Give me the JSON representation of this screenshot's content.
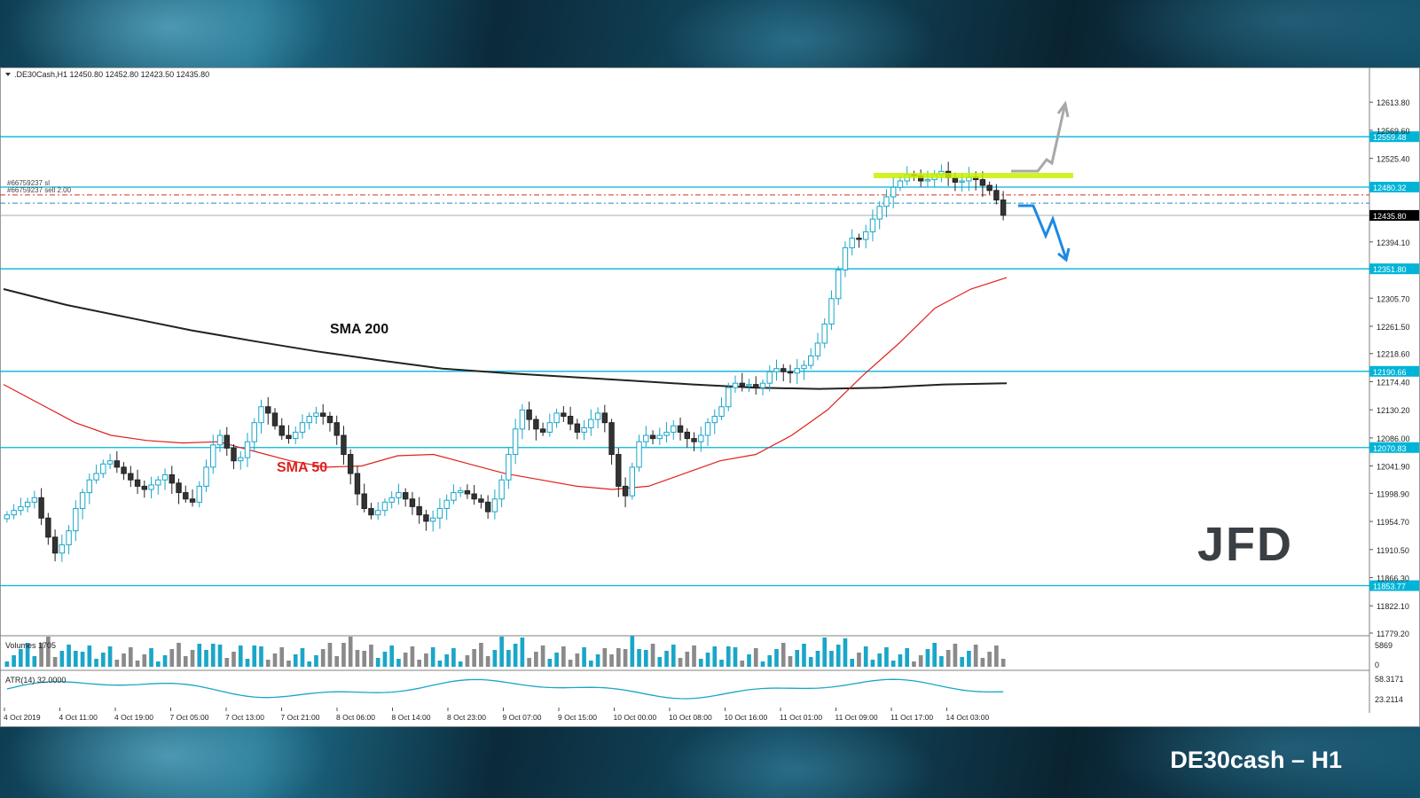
{
  "caption": "DE30cash – H1",
  "logo_text": "JFD",
  "header": {
    "symbol_line": ".DE30Cash,H1  12450.80 12452.80 12423.50 12435.80"
  },
  "chart_data": {
    "type": "candlestick",
    "title": ".DE30Cash,H1",
    "ohlc_header": {
      "open": 12450.8,
      "high": 12452.8,
      "low": 12423.5,
      "close": 12435.8
    },
    "ylim": [
      11779.2,
      12635.0
    ],
    "price_ticks": [
      "12613.80",
      "12569.60",
      "12525.40",
      "12394.10",
      "12305.70",
      "12261.50",
      "12218.60",
      "12174.40",
      "12130.20",
      "12086.00",
      "12041.90",
      "11998.90",
      "11954.70",
      "11910.50",
      "11866.30",
      "11822.10",
      "11779.20"
    ],
    "time_labels": [
      "4 Oct 2019",
      "4 Oct 11:00",
      "4 Oct 19:00",
      "7 Oct 05:00",
      "7 Oct 13:00",
      "7 Oct 21:00",
      "8 Oct 06:00",
      "8 Oct 14:00",
      "8 Oct 23:00",
      "9 Oct 07:00",
      "9 Oct 15:00",
      "10 Oct 00:00",
      "10 Oct 08:00",
      "10 Oct 16:00",
      "11 Oct 01:00",
      "11 Oct 09:00",
      "11 Oct 17:00",
      "14 Oct 03:00"
    ],
    "levels": [
      {
        "value": 12559.48,
        "label": "12559.48"
      },
      {
        "value": 12480.32,
        "label": "12480.32"
      },
      {
        "value": 12351.8,
        "label": "12351.80"
      },
      {
        "value": 12190.66,
        "label": "12190.66"
      },
      {
        "value": 12070.83,
        "label": "12070.83"
      },
      {
        "value": 11853.77,
        "label": "11853.77"
      }
    ],
    "current_price": {
      "value": 12435.8,
      "label": "12435.80"
    },
    "order_lines": [
      {
        "label": "#66759237 sl",
        "value": 12468.0,
        "color": "#d0302c"
      },
      {
        "label": "#66759237 sell 2.00",
        "value": 12455.0,
        "color": "#1e8fb8"
      }
    ],
    "indicators": {
      "sma200_label": "SMA 200",
      "sma50_label": "SMA 50",
      "volumes_label": "Volumes 1705",
      "volume_ticks": [
        "5869",
        "0"
      ],
      "atr_label": "ATR(14) 32.0000",
      "atr_ticks": [
        "58.3171",
        "23.2114"
      ]
    },
    "candles_close": [
      11965,
      11972,
      11978,
      11985,
      11992,
      11960,
      11930,
      11905,
      11918,
      11940,
      11975,
      12000,
      12020,
      12030,
      12045,
      12050,
      12040,
      12030,
      12020,
      12010,
      12005,
      12012,
      12020,
      12028,
      12015,
      12000,
      11990,
      11985,
      12010,
      12040,
      12075,
      12090,
      12070,
      12050,
      12055,
      12080,
      12110,
      12135,
      12125,
      12105,
      12090,
      12085,
      12095,
      12110,
      12120,
      12125,
      12120,
      12110,
      12090,
      12060,
      12030,
      11998,
      11975,
      11965,
      11972,
      11985,
      11992,
      12000,
      11990,
      11978,
      11965,
      11955,
      11960,
      11975,
      11988,
      12000,
      12003,
      11998,
      11990,
      11985,
      11970,
      11990,
      12020,
      12060,
      12100,
      12130,
      12115,
      12100,
      12095,
      12110,
      12125,
      12120,
      12108,
      12095,
      12102,
      12115,
      12125,
      12110,
      12060,
      12010,
      11995,
      12040,
      12080,
      12090,
      12085,
      12090,
      12095,
      12105,
      12095,
      12085,
      12080,
      12090,
      12110,
      12120,
      12135,
      12165,
      12172,
      12168,
      12170,
      12165,
      12172,
      12190,
      12195,
      12190,
      12188,
      12195,
      12200,
      12215,
      12235,
      12265,
      12305,
      12350,
      12385,
      12400,
      12398,
      12410,
      12430,
      12450,
      12465,
      12480,
      12490,
      12500,
      12498,
      12490,
      12492,
      12500,
      12505,
      12495,
      12488,
      12490,
      12496,
      12492,
      12483,
      12475,
      12460,
      12436
    ],
    "sma50": [
      12170,
      12140,
      12110,
      12090,
      12082,
      12078,
      12080,
      12065,
      12050,
      12040,
      12042,
      12058,
      12060,
      12045,
      12030,
      12020,
      12010,
      12005,
      12010,
      12030,
      12050,
      12060,
      12090,
      12130,
      12185,
      12235,
      12290,
      12320,
      12338
    ],
    "sma200": [
      12320,
      12295,
      12275,
      12255,
      12238,
      12222,
      12208,
      12195,
      12188,
      12182,
      12176,
      12170,
      12165,
      12163,
      12165,
      12170,
      12172
    ]
  }
}
